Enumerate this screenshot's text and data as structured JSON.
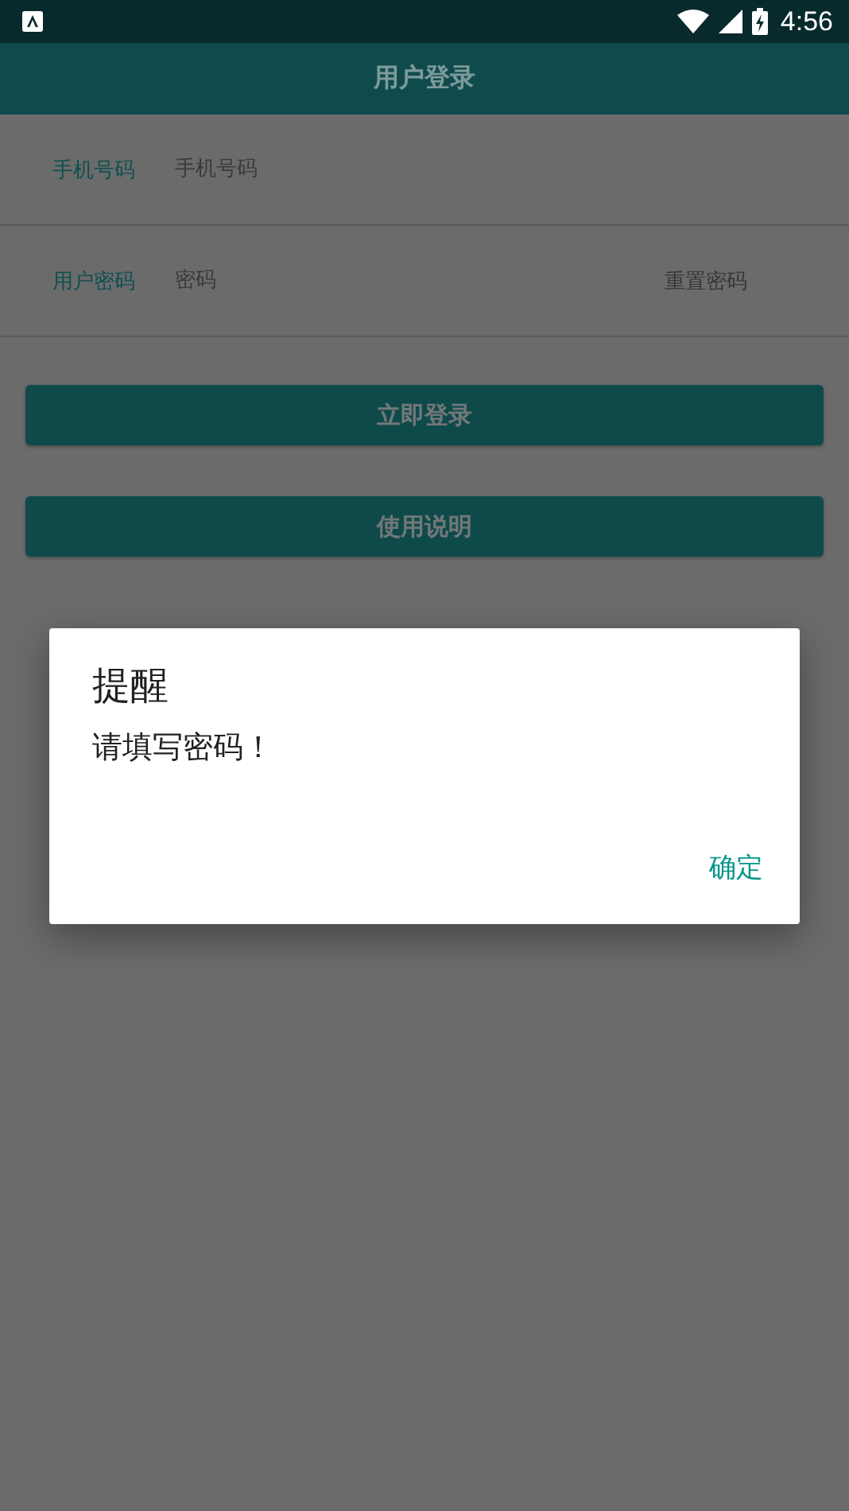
{
  "status_bar": {
    "time": "4:56"
  },
  "app_bar": {
    "title": "用户登录"
  },
  "fields": [
    {
      "label": "手机号码",
      "placeholder": "手机号码"
    },
    {
      "label": "用户密码",
      "placeholder": "密码",
      "action": "重置密码"
    }
  ],
  "buttons": [
    "立即登录",
    "使用说明"
  ],
  "dialog": {
    "title": "提醒",
    "message": "请填写密码！",
    "buttons": [
      "确定"
    ]
  }
}
